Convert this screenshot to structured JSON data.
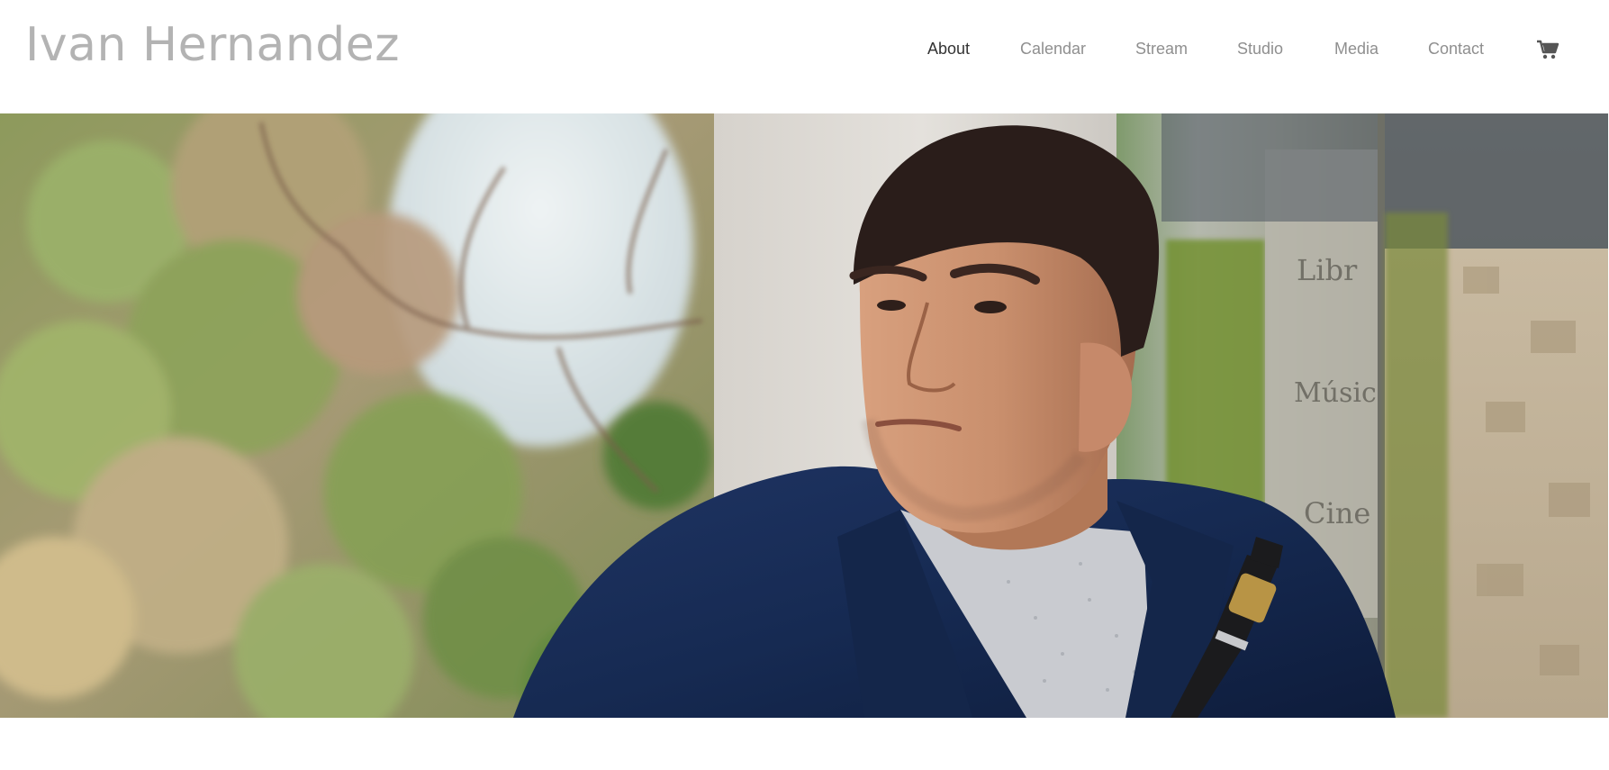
{
  "header": {
    "site_title": "Ivan Hernandez",
    "nav": [
      {
        "label": "About",
        "active": true
      },
      {
        "label": "Calendar",
        "active": false
      },
      {
        "label": "Stream",
        "active": false
      },
      {
        "label": "Studio",
        "active": false
      },
      {
        "label": "Media",
        "active": false
      },
      {
        "label": "Contact",
        "active": false
      }
    ],
    "cart_icon": "shopping-cart-icon"
  },
  "hero": {
    "sign_lines": [
      "Libr",
      "Música",
      "Cine"
    ]
  },
  "colors": {
    "title": "#b3b3b3",
    "nav_active": "#333333",
    "nav_inactive": "#8f8f8f",
    "cart": "#555555",
    "background": "#ffffff"
  }
}
